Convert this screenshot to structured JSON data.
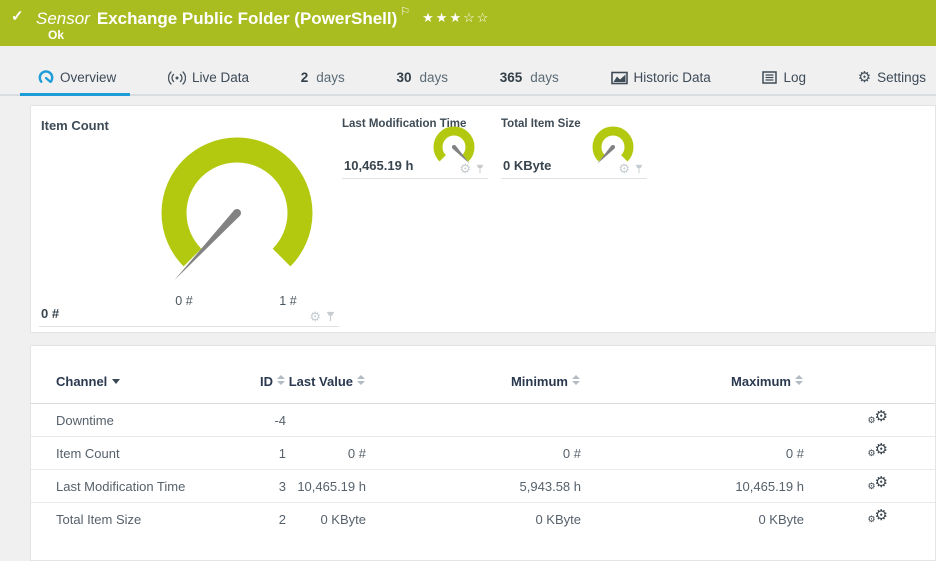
{
  "colors": {
    "header_green": "#a9bd21",
    "gauge_green": "#b3c90f",
    "accent_blue": "#1e9cd7"
  },
  "icons": {
    "check": "✓",
    "flag": "⚐",
    "gear": "⚙"
  },
  "header": {
    "kind_label": "Sensor",
    "title": "Exchange Public Folder (PowerShell)",
    "stars": "★★★☆☆",
    "status_text": "Ok"
  },
  "tabs": {
    "overview": {
      "label": "Overview"
    },
    "live_data": {
      "label": "Live Data"
    },
    "days2": {
      "num": "2",
      "unit": "days"
    },
    "days30": {
      "num": "30",
      "unit": "days"
    },
    "days365": {
      "num": "365",
      "unit": "days"
    },
    "historic": {
      "label": "Historic Data"
    },
    "log": {
      "label": "Log"
    },
    "settings": {
      "label": "Settings"
    }
  },
  "gauges": {
    "item_count": {
      "title": "Item Count",
      "value": "0 #",
      "scale_min": "0 #",
      "scale_max": "1 #"
    },
    "last_modification_time": {
      "title": "Last Modification Time",
      "value": "10,465.19 h"
    },
    "total_item_size": {
      "title": "Total Item Size",
      "value": "0 KByte"
    }
  },
  "table": {
    "columns": {
      "channel": "Channel",
      "id": "ID",
      "last_value": "Last Value",
      "minimum": "Minimum",
      "maximum": "Maximum"
    },
    "rows": [
      {
        "channel": "Downtime",
        "id": "-4",
        "last_value": "",
        "minimum": "",
        "maximum": ""
      },
      {
        "channel": "Item Count",
        "id": "1",
        "last_value": "0 #",
        "minimum": "0 #",
        "maximum": "0 #"
      },
      {
        "channel": "Last Modification Time",
        "id": "3",
        "last_value": "10,465.19 h",
        "minimum": "5,943.58 h",
        "maximum": "10,465.19 h"
      },
      {
        "channel": "Total Item Size",
        "id": "2",
        "last_value": "0 KByte",
        "minimum": "0 KByte",
        "maximum": "0 KByte"
      }
    ]
  }
}
